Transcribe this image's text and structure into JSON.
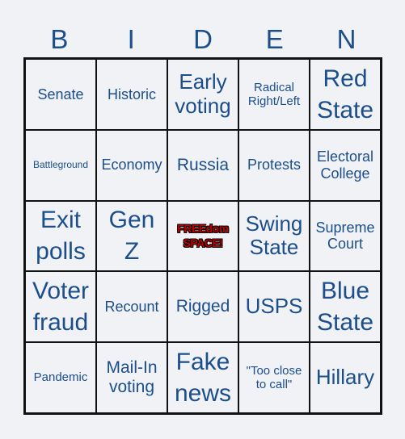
{
  "title_letters": [
    "B",
    "I",
    "D",
    "E",
    "N"
  ],
  "colors": {
    "text": "#1c4e8b",
    "free_space": "#c00000",
    "grid_line": "#111111",
    "background": "#f0f2f5"
  },
  "cells": [
    {
      "label": "Senate",
      "size": "md"
    },
    {
      "label": "Historic",
      "size": "md"
    },
    {
      "label": "Early voting",
      "size": "xl"
    },
    {
      "label": "Radical Right/Left",
      "size": "sm"
    },
    {
      "label": "Red State",
      "size": "xxl"
    },
    {
      "label": "Battleground",
      "size": "xs"
    },
    {
      "label": "Economy",
      "size": "md"
    },
    {
      "label": "Russia",
      "size": "lg"
    },
    {
      "label": "Protests",
      "size": "md"
    },
    {
      "label": "Electoral College",
      "size": "md"
    },
    {
      "label": "Exit polls",
      "size": "xxl"
    },
    {
      "label": "Gen Z",
      "size": "xxl"
    },
    {
      "label": "FREEdom SPACE!",
      "size": "free"
    },
    {
      "label": "Swing State",
      "size": "xl"
    },
    {
      "label": "Supreme Court",
      "size": "md"
    },
    {
      "label": "Voter fraud",
      "size": "xxl"
    },
    {
      "label": "Recount",
      "size": "md"
    },
    {
      "label": "Rigged",
      "size": "lg"
    },
    {
      "label": "USPS",
      "size": "xl"
    },
    {
      "label": "Blue State",
      "size": "xxl"
    },
    {
      "label": "Pandemic",
      "size": "sm"
    },
    {
      "label": "Mail-In voting",
      "size": "lg"
    },
    {
      "label": "Fake news",
      "size": "xxl"
    },
    {
      "label": "\"Too close to call\"",
      "size": "sm"
    },
    {
      "label": "Hillary",
      "size": "xl"
    }
  ]
}
